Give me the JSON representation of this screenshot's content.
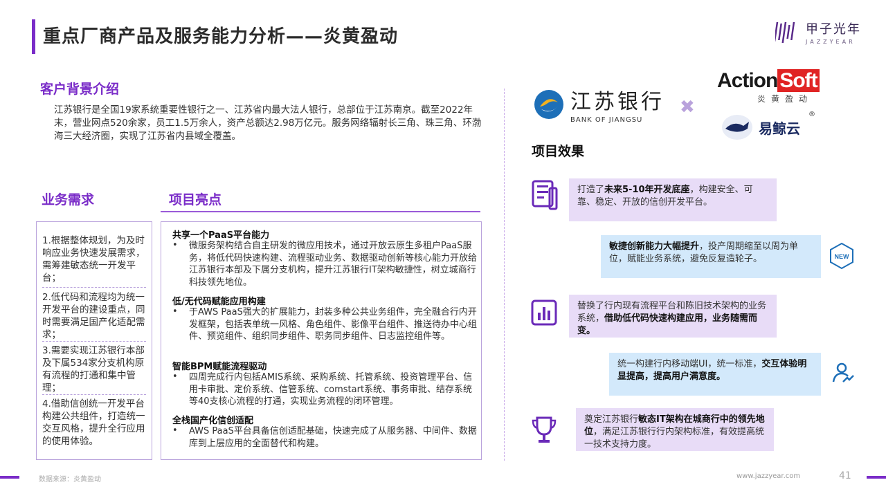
{
  "header": {
    "title": "重点厂商产品及服务能力分析——炎黄盈动",
    "logo_cn": "甲子光年",
    "logo_en": "JAZZYEAR"
  },
  "background": {
    "heading": "客户背景介绍",
    "text": "江苏银行是全国19家系统重要性银行之一、江苏省内最大法人银行，总部位于江苏南京。截至2022年末，营业网点520余家，员工1.5万余人，资产总额达2.98万亿元。服务网络辐射长三角、珠三角、环渤海三大经济圈，实现了江苏省内县域全覆盖。"
  },
  "needs": {
    "heading": "业务需求",
    "items": [
      "1.根据整体规划，为及时响应业务快速发展需求，需筹建敏态统一开发平台；",
      "2.低代码和流程均为统一开发平台的建设重点，同时需要满足国产化适配需求；",
      "3.需要实现江苏银行本部及下属534家分支机构原有流程的打通和集中管理；",
      "4.借助信创统一开发平台构建公共组件，打造统一交互风格，提升全行应用的使用体验。"
    ]
  },
  "highlights": {
    "heading": "项目亮点",
    "bullet": "•",
    "items": [
      {
        "title": "共享一个PaaS平台能力",
        "body": "微服务架构结合自主研发的微应用技术，通过开放云原生多租户PaaS服务，将低代码快速构建、流程驱动业务、数据驱动创新等核心能力开放给江苏银行本部及下属分支机构，提升江苏银行IT架构敏捷性，树立城商行科技领先地位。"
      },
      {
        "title": "低/无代码赋能应用构建",
        "body": "于AWS PaaS强大的扩展能力，封装多种公共业务组件，完全融合行内开发框架，包括表单统一风格、角色组件、影像平台组件、推送待办中心组件、预览组件、组织同步组件、职务同步组件、日志监控组件等。"
      },
      {
        "title": "智能BPM赋能流程驱动",
        "body": "四周完成行内包括AMIS系统、采购系统、托管系统、投资管理平台、信用卡审批、定价系统、信管系统、comstart系统、事务审批、结存系统等40支核心流程的打通，实现业务流程的闭环管理。"
      },
      {
        "title": "全栈国产化信创适配",
        "body": "AWS PaaS平台具备信创适配基础，快速完成了从服务器、中间件、数据库到上层应用的全面替代和构建。"
      }
    ]
  },
  "logos": {
    "bank_cn": "江苏银行",
    "bank_en": "BANK OF JIANGSU",
    "cross": "✖",
    "actionsoft_a": "Action",
    "actionsoft_b": "Soft",
    "actionsoft_sub": "炎黄盈动",
    "yijing": "易鲸云",
    "reg": "®"
  },
  "effects": {
    "heading": "项目效果",
    "items": [
      {
        "pre": "打造了",
        "bold": "未来5-10年开发底座",
        "post": "，构建安全、可靠、稳定、开放的信创开发平台。",
        "icon": "document-list-icon"
      },
      {
        "pre": "",
        "bold": "敏捷创新能力大幅提升",
        "post": "，投产周期缩至以周为单位，赋能业务系统，避免反复造轮子。",
        "icon": "new-badge-icon",
        "badge": "NEW"
      },
      {
        "pre": "替换了行内现有流程平台和陈旧技术架构的业务系统，",
        "bold": "借助低代码快速构建应用，业务随需而变。",
        "post": "",
        "icon": "bar-chart-icon"
      },
      {
        "pre": "统一构建行内移动端UI，统一标准，",
        "bold": "交互体验明显提高，提高用户满意度。",
        "post": "",
        "icon": "user-growth-icon"
      },
      {
        "pre": "奠定江苏银行",
        "bold": "敏态IT架构在城商行中的领先地位",
        "post": "，满足江苏银行行内架构标准，有效提高统一技术支持力度。",
        "icon": "trophy-icon"
      }
    ]
  },
  "footer": {
    "source": "数据来源：炎黄盈动",
    "url": "www.jazzyear.com",
    "page": "41"
  },
  "colors": {
    "accent": "#7a2cc8",
    "purple_box": "#e8dcf7",
    "blue_box": "#d3e9fb"
  }
}
